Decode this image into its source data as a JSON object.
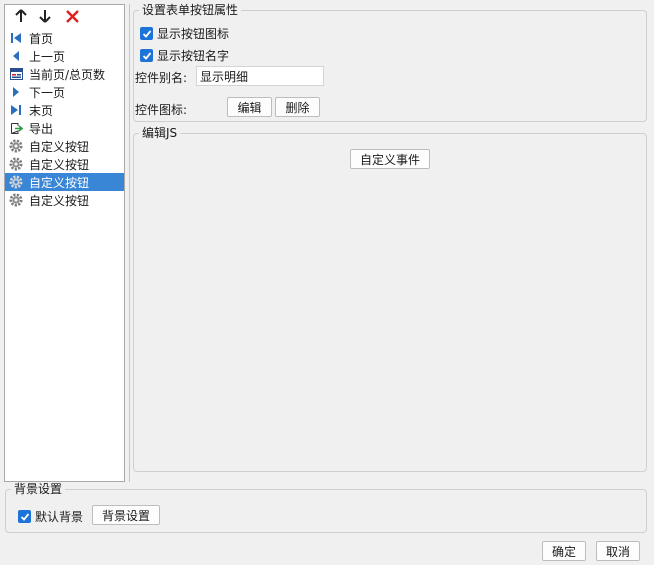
{
  "toolbar": {
    "up_icon": "arrow-up-icon",
    "down_icon": "arrow-down-icon",
    "delete_icon": "delete-x-icon",
    "delete_color": "#e02020"
  },
  "button_list": [
    {
      "label": "首页",
      "icon": "first-page-icon"
    },
    {
      "label": "上一页",
      "icon": "prev-page-icon"
    },
    {
      "label": "当前页/总页数",
      "icon": "page-count-icon"
    },
    {
      "label": "下一页",
      "icon": "next-page-icon"
    },
    {
      "label": "末页",
      "icon": "last-page-icon"
    },
    {
      "label": "导出",
      "icon": "export-icon"
    },
    {
      "label": "自定义按钮",
      "icon": "gear-icon"
    },
    {
      "label": "自定义按钮",
      "icon": "gear-icon"
    },
    {
      "label": "自定义按钮",
      "icon": "gear-icon",
      "selected": true
    },
    {
      "label": "自定义按钮",
      "icon": "gear-icon"
    }
  ],
  "props": {
    "legend": "设置表单按钮属性",
    "show_icon_label": "显示按钮图标",
    "show_icon_checked": true,
    "show_name_label": "显示按钮名字",
    "show_name_checked": true,
    "alias_label": "控件别名:",
    "alias_value": "显示明细",
    "icon_label": "控件图标:",
    "edit_button": "编辑",
    "delete_button": "删除"
  },
  "js": {
    "legend": "编辑JS",
    "custom_event_button": "自定义事件"
  },
  "background": {
    "legend": "背景设置",
    "default_label": "默认背景",
    "default_checked": true,
    "settings_button": "背景设置"
  },
  "footer": {
    "ok_button": "确定",
    "cancel_button": "取消"
  },
  "colors": {
    "selection": "#3a86d6",
    "checkbox": "#1e73d8"
  }
}
